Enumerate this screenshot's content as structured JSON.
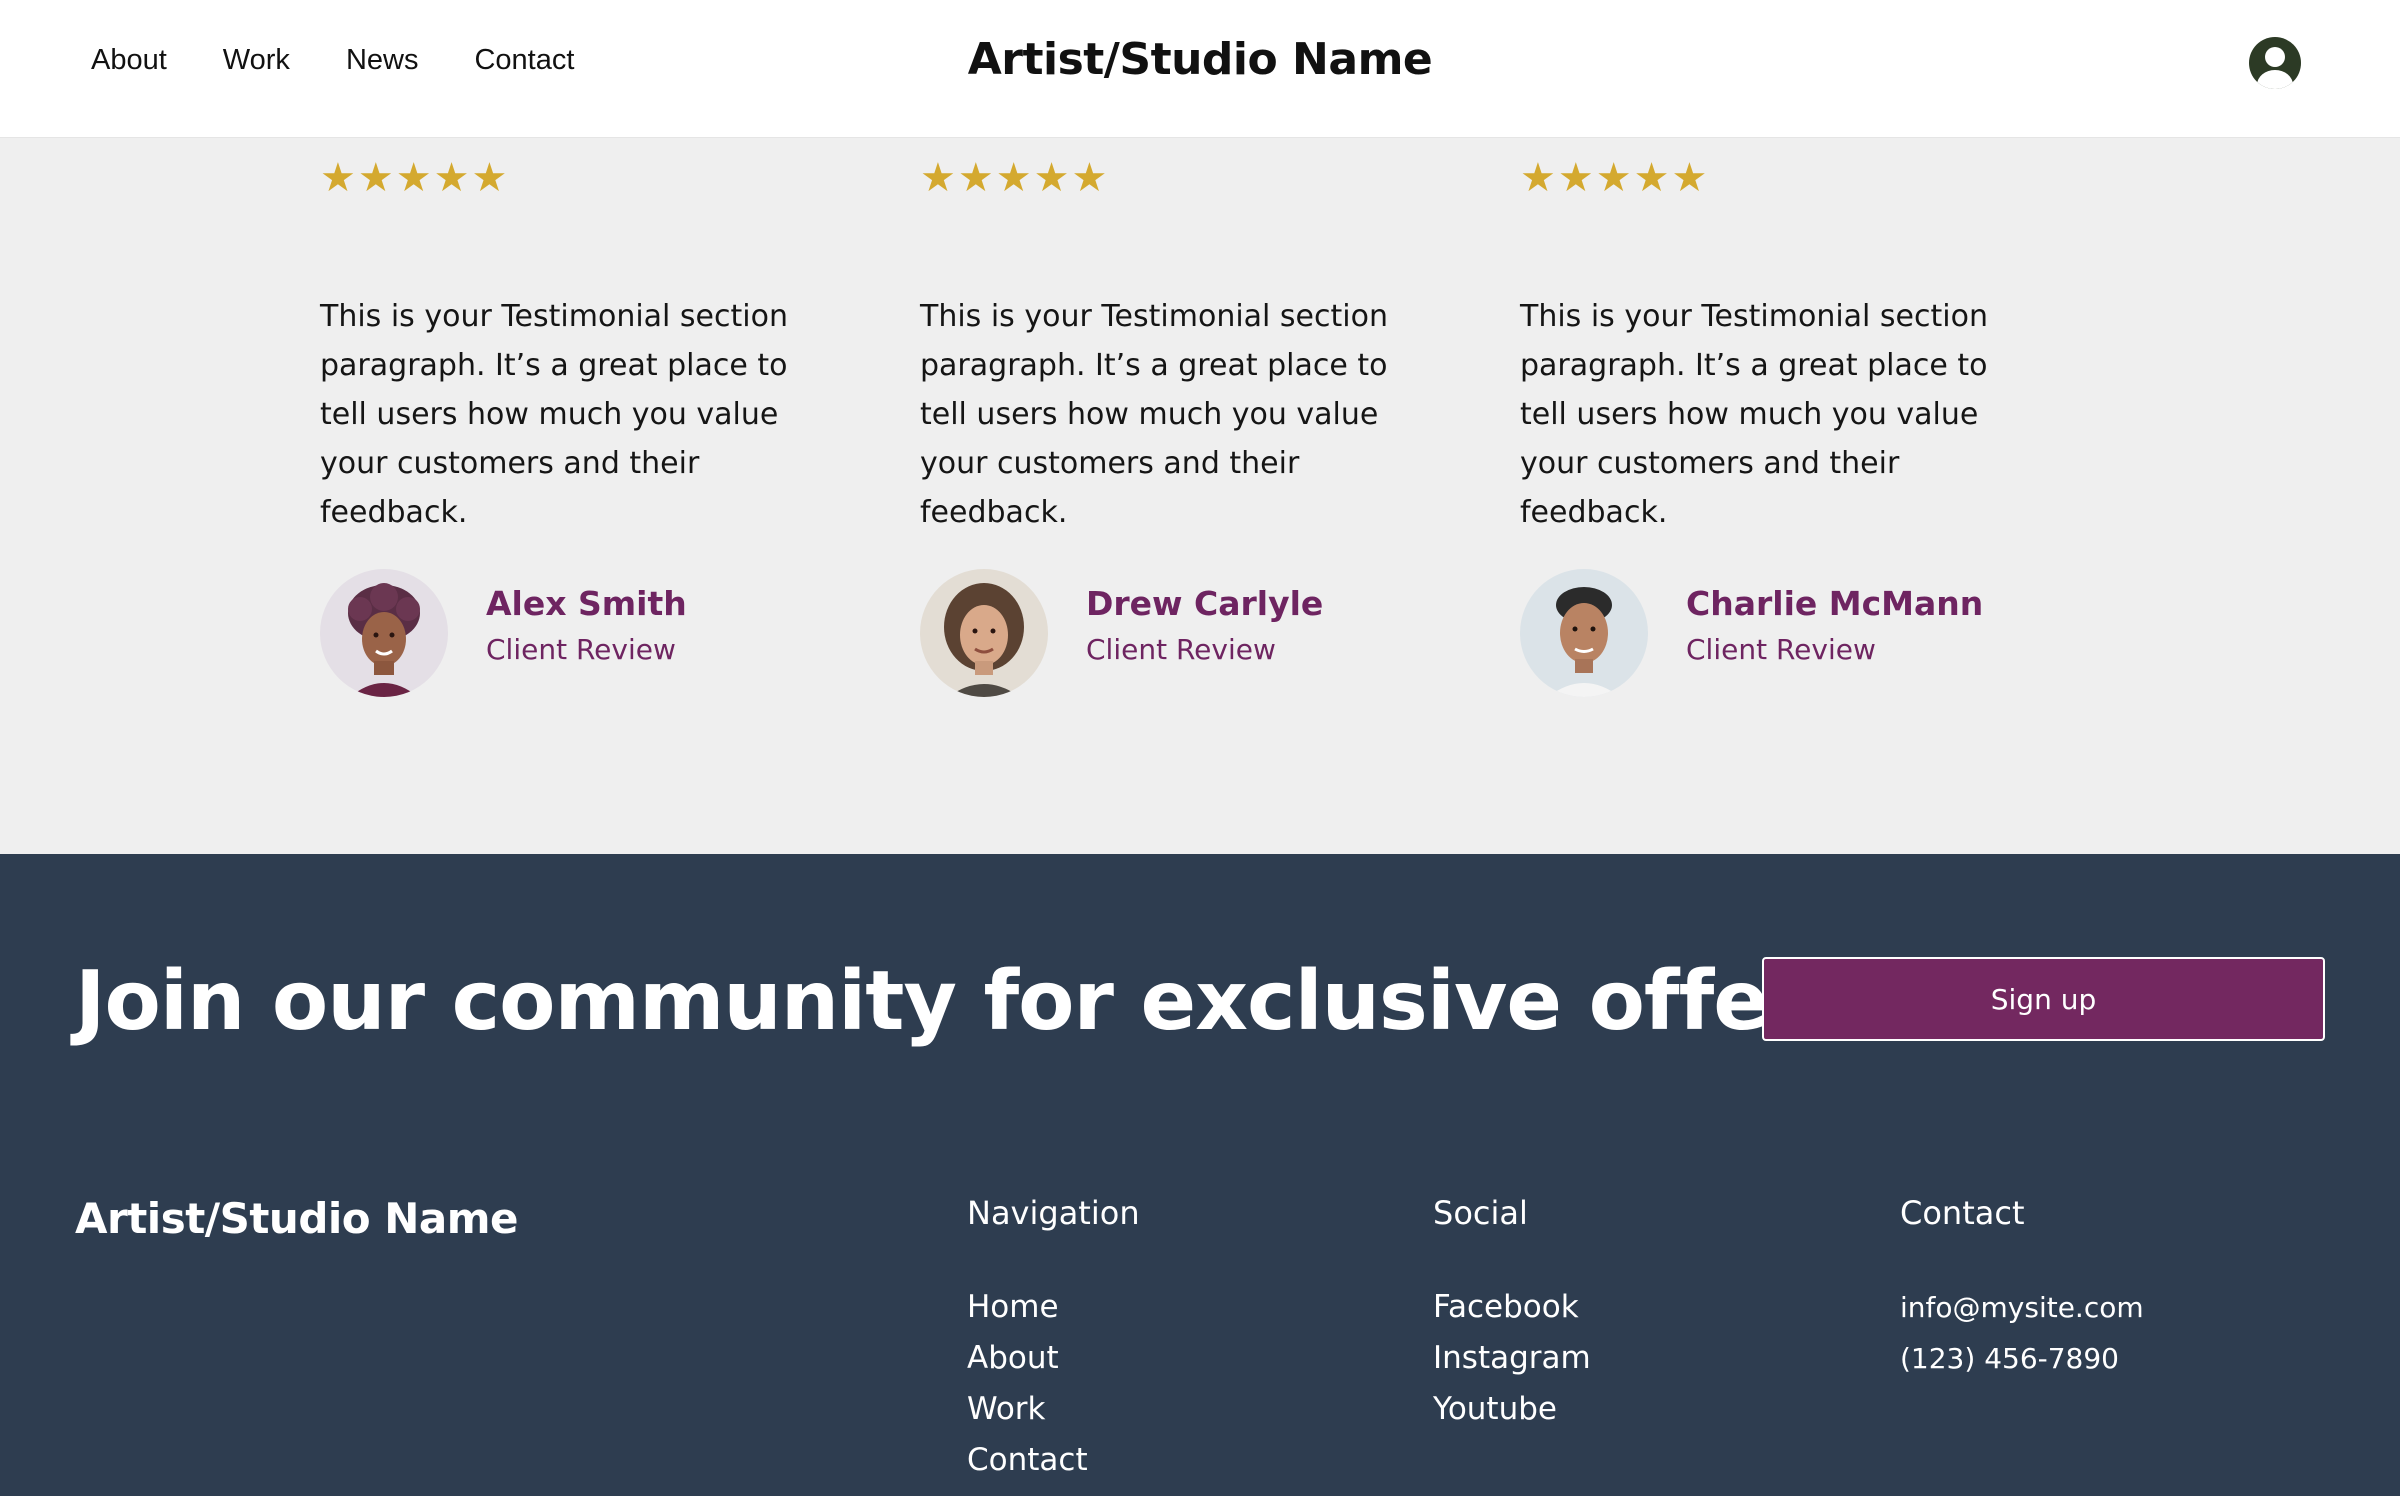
{
  "header": {
    "nav": [
      "About",
      "Work",
      "News",
      "Contact"
    ],
    "title": "Artist/Studio Name",
    "user_icon": "user-avatar-icon"
  },
  "testimonials": [
    {
      "rating": 5,
      "stars": "★★★★★",
      "quote": "This is your Testimonial section paragraph. It’s a great place to tell users how much you value your customers and their feedback.",
      "name": "Alex Smith",
      "role": "Client Review"
    },
    {
      "rating": 5,
      "stars": "★★★★★",
      "quote": "This is your Testimonial section paragraph. It’s a great place to tell users how much you value your customers and their feedback.",
      "name": "Drew Carlyle",
      "role": "Client Review"
    },
    {
      "rating": 5,
      "stars": "★★★★★",
      "quote": "This is your Testimonial section paragraph. It’s a great place to tell users how much you value your customers and their feedback.",
      "name": "Charlie McMann",
      "role": "Client Review"
    }
  ],
  "footer": {
    "cta_heading": "Join our community for exclusive offers",
    "signup_label": "Sign up",
    "brand": "Artist/Studio Name",
    "navigation": {
      "title": "Navigation",
      "links": [
        "Home",
        "About",
        "Work",
        "Contact"
      ]
    },
    "social": {
      "title": "Social",
      "links": [
        "Facebook",
        "Instagram",
        "Youtube"
      ]
    },
    "contact": {
      "title": "Contact",
      "email": "info@mysite.com",
      "phone": "(123) 456-7890"
    }
  },
  "colors": {
    "accent": "#732860",
    "reviewer_text": "#6e2461",
    "star": "#d4a92f",
    "footer_bg": "#2e3d50",
    "section_bg": "#efefef"
  }
}
